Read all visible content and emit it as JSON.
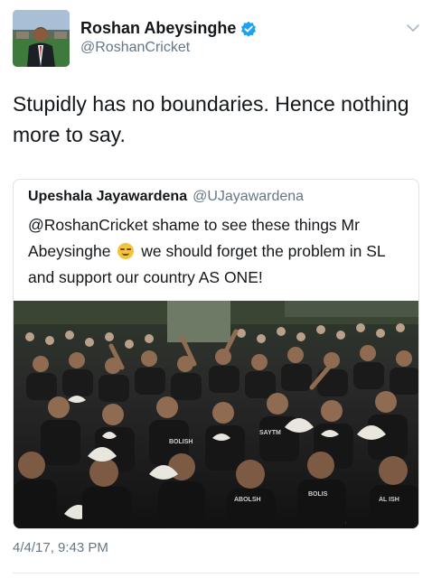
{
  "author": {
    "name": "Roshan Abeysinghe",
    "handle": "@RoshanCricket",
    "verified": true
  },
  "tweet": {
    "text": "Stupidly has no boundaries. Hence nothing more to say.",
    "timestamp": "4/4/17, 9:43 PM"
  },
  "quoted_tweet": {
    "name": "Upeshala Jayawardena",
    "handle": "@UJayawardena",
    "text_before_emoji": "@RoshanCricket shame to see these things Mr Abeysinghe",
    "emoji": "relieved-face",
    "text_after_emoji": "we should forget the problem in SL and support our country AS ONE!"
  },
  "colors": {
    "primary_text": "#14171a",
    "secondary_text": "#657786",
    "verified_blue": "#1da1f2",
    "border": "#dfe3e8"
  },
  "icons": {
    "verified": "verified-badge-icon",
    "menu": "chevron-down-icon"
  }
}
